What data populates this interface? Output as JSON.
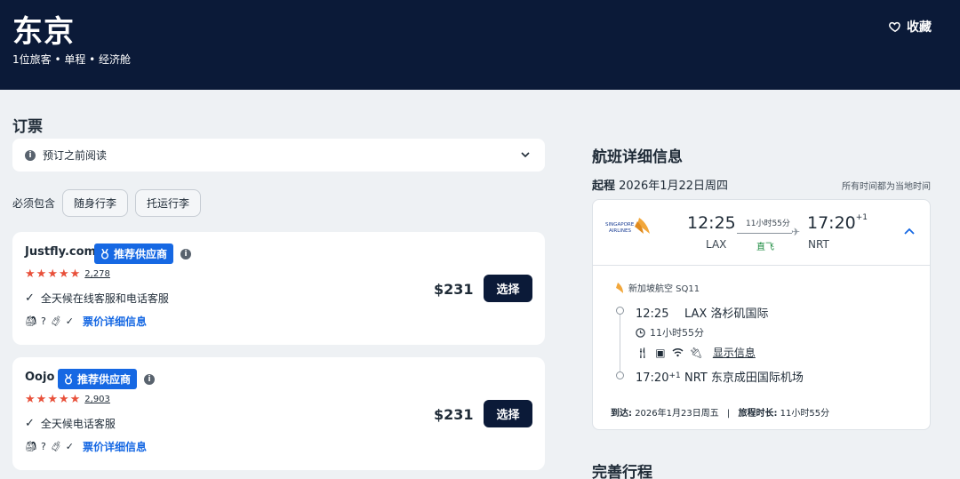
{
  "header": {
    "title": "东京",
    "subtitle": "1位旅客 • 单程 • 经济舱",
    "save_label": "收藏"
  },
  "booking": {
    "title": "订票",
    "read_before": "预订之前阅读",
    "must_include_label": "必须包含",
    "filters": [
      "随身行李",
      "托运行李"
    ]
  },
  "offers": [
    {
      "vendor": "Justfly.com",
      "badge": "推荐供应商",
      "rating_count": "2,278",
      "feature": "全天候在线客服和电话客服",
      "bag_q": "?",
      "fare_link": "票价详细信息",
      "price": "$231",
      "select_label": "选择"
    },
    {
      "vendor": "Oojo",
      "badge": "推荐供应商",
      "rating_count": "2,903",
      "feature": "全天候电话客服",
      "bag_q": "?",
      "fare_link": "票价详细信息",
      "price": "$231",
      "select_label": "选择"
    }
  ],
  "flight": {
    "title": "航班详细信息",
    "leg_label": "起程",
    "leg_date": "2026年1月22日周四",
    "tz_note": "所有时间都为当地时间",
    "depart_time": "12:25",
    "depart_code": "LAX",
    "duration": "11小时55分",
    "direct": "直飞",
    "arrive_time": "17:20",
    "arrive_plus": "+1",
    "arrive_code": "NRT",
    "airline": "新加坡航空 SQ11",
    "logo_text_1": "SINGAPORE",
    "logo_text_2": "AIRLINES",
    "stop1_time": "12:25",
    "stop1_name": "LAX 洛杉矶国际",
    "mid_duration": "11小时55分",
    "show_info": "显示信息",
    "stop2_time": "17:20",
    "stop2_plus": "+1",
    "stop2_name": "NRT 东京成田国际机场",
    "arrive_label": "到达:",
    "arrive_date": "2026年1月23日周五",
    "total_label": "旅程时长:",
    "total_duration": "11小时55分"
  },
  "complete": {
    "title": "完善行程"
  },
  "colors": {
    "header_bg": "#0b1a38",
    "accent": "#1668e3",
    "star": "#e8503a",
    "direct": "#1b8a3f"
  }
}
